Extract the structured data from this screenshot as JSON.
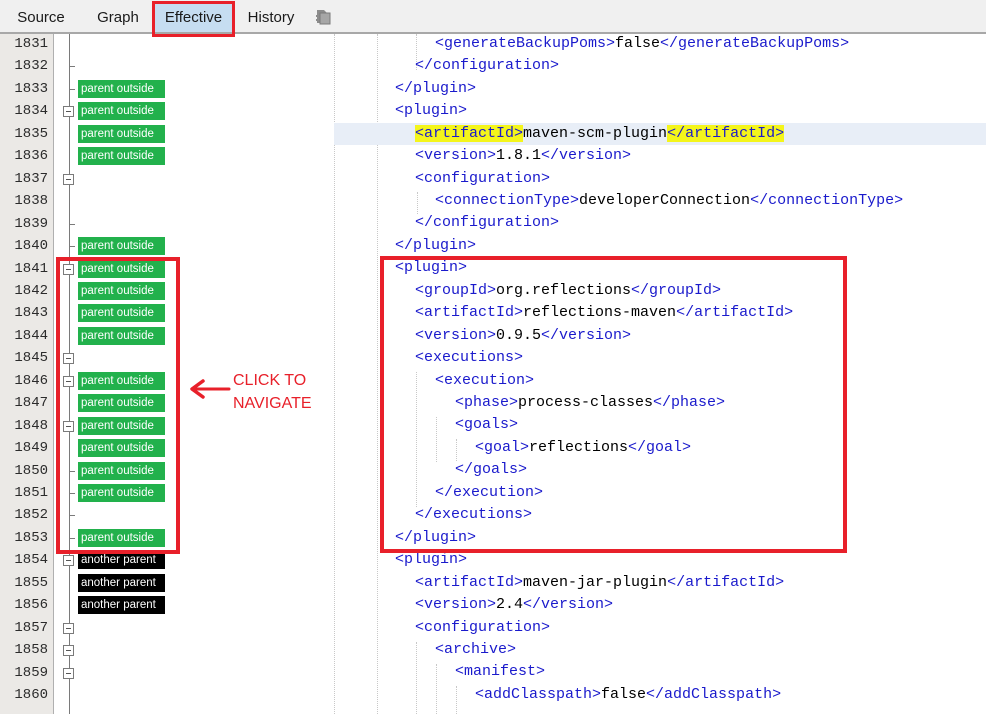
{
  "tabs": [
    {
      "label": "Source",
      "active": false
    },
    {
      "label": "Graph",
      "active": false
    },
    {
      "label": "Effective",
      "active": true
    },
    {
      "label": "History",
      "active": false
    }
  ],
  "toolbar_icon": "document-copy-icon",
  "colors": {
    "badge_parent_outside": "#22b14c",
    "badge_another_parent": "#000000",
    "annotation_red": "#e8202a",
    "tag_blue": "#1a1acc",
    "highlight_yellow": "#f4f51b",
    "active_tab": "#c6ddf1"
  },
  "lines": [
    {
      "no": "1831",
      "badge": null,
      "fold": false,
      "tick": false,
      "indent": 2,
      "parts": [
        [
          "t",
          "<generateBackupPoms>"
        ],
        [
          "x",
          "false"
        ],
        [
          "t",
          "</generateBackupPoms>"
        ]
      ]
    },
    {
      "no": "1832",
      "badge": null,
      "fold": false,
      "tick": true,
      "indent": 1,
      "parts": [
        [
          "t",
          "</configuration>"
        ]
      ]
    },
    {
      "no": "1833",
      "badge": "parent outside",
      "badge_kind": "green",
      "fold": false,
      "tick": true,
      "indent": 0,
      "parts": [
        [
          "t",
          "</plugin>"
        ]
      ]
    },
    {
      "no": "1834",
      "badge": "parent outside",
      "badge_kind": "green",
      "fold": true,
      "tick": false,
      "indent": 0,
      "parts": [
        [
          "t",
          "<plugin>"
        ]
      ]
    },
    {
      "no": "1835",
      "badge": "parent outside",
      "badge_kind": "green",
      "fold": false,
      "tick": false,
      "indent": 1,
      "current": true,
      "parts": [
        [
          "th",
          "<artifactId>"
        ],
        [
          "x",
          "maven-scm-plugin"
        ],
        [
          "th",
          "</artifactId>"
        ]
      ]
    },
    {
      "no": "1836",
      "badge": "parent outside",
      "badge_kind": "green",
      "fold": false,
      "tick": false,
      "indent": 1,
      "parts": [
        [
          "t",
          "<version>"
        ],
        [
          "x",
          "1.8.1"
        ],
        [
          "t",
          "</version>"
        ]
      ]
    },
    {
      "no": "1837",
      "badge": null,
      "fold": true,
      "tick": false,
      "indent": 1,
      "parts": [
        [
          "t",
          "<configuration>"
        ]
      ]
    },
    {
      "no": "1838",
      "badge": null,
      "fold": false,
      "tick": false,
      "indent": 2,
      "parts": [
        [
          "t",
          "<connectionType>"
        ],
        [
          "x",
          "developerConnection"
        ],
        [
          "t",
          "</connectionType>"
        ]
      ]
    },
    {
      "no": "1839",
      "badge": null,
      "fold": false,
      "tick": true,
      "indent": 1,
      "parts": [
        [
          "t",
          "</configuration>"
        ]
      ]
    },
    {
      "no": "1840",
      "badge": "parent outside",
      "badge_kind": "green",
      "fold": false,
      "tick": true,
      "indent": 0,
      "parts": [
        [
          "t",
          "</plugin>"
        ]
      ]
    },
    {
      "no": "1841",
      "badge": "parent outside",
      "badge_kind": "green",
      "fold": true,
      "tick": false,
      "indent": 0,
      "parts": [
        [
          "t",
          "<plugin>"
        ]
      ]
    },
    {
      "no": "1842",
      "badge": "parent outside",
      "badge_kind": "green",
      "fold": false,
      "tick": false,
      "indent": 1,
      "parts": [
        [
          "t",
          "<groupId>"
        ],
        [
          "x",
          "org.reflections"
        ],
        [
          "t",
          "</groupId>"
        ]
      ]
    },
    {
      "no": "1843",
      "badge": "parent outside",
      "badge_kind": "green",
      "fold": false,
      "tick": false,
      "indent": 1,
      "parts": [
        [
          "t",
          "<artifactId>"
        ],
        [
          "x",
          "reflections-maven"
        ],
        [
          "t",
          "</artifactId>"
        ]
      ]
    },
    {
      "no": "1844",
      "badge": "parent outside",
      "badge_kind": "green",
      "fold": false,
      "tick": false,
      "indent": 1,
      "parts": [
        [
          "t",
          "<version>"
        ],
        [
          "x",
          "0.9.5"
        ],
        [
          "t",
          "</version>"
        ]
      ]
    },
    {
      "no": "1845",
      "badge": null,
      "fold": true,
      "tick": false,
      "indent": 1,
      "parts": [
        [
          "t",
          "<executions>"
        ]
      ]
    },
    {
      "no": "1846",
      "badge": "parent outside",
      "badge_kind": "green",
      "fold": true,
      "tick": false,
      "indent": 2,
      "parts": [
        [
          "t",
          "<execution>"
        ]
      ]
    },
    {
      "no": "1847",
      "badge": "parent outside",
      "badge_kind": "green",
      "fold": false,
      "tick": false,
      "indent": 3,
      "parts": [
        [
          "t",
          "<phase>"
        ],
        [
          "x",
          "process-classes"
        ],
        [
          "t",
          "</phase>"
        ]
      ]
    },
    {
      "no": "1848",
      "badge": "parent outside",
      "badge_kind": "green",
      "fold": true,
      "tick": false,
      "indent": 3,
      "parts": [
        [
          "t",
          "<goals>"
        ]
      ]
    },
    {
      "no": "1849",
      "badge": "parent outside",
      "badge_kind": "green",
      "fold": false,
      "tick": false,
      "indent": 4,
      "parts": [
        [
          "t",
          "<goal>"
        ],
        [
          "x",
          "reflections"
        ],
        [
          "t",
          "</goal>"
        ]
      ]
    },
    {
      "no": "1850",
      "badge": "parent outside",
      "badge_kind": "green",
      "fold": false,
      "tick": true,
      "indent": 3,
      "parts": [
        [
          "t",
          "</goals>"
        ]
      ]
    },
    {
      "no": "1851",
      "badge": "parent outside",
      "badge_kind": "green",
      "fold": false,
      "tick": true,
      "indent": 2,
      "parts": [
        [
          "t",
          "</execution>"
        ]
      ]
    },
    {
      "no": "1852",
      "badge": null,
      "fold": false,
      "tick": true,
      "indent": 1,
      "parts": [
        [
          "t",
          "</executions>"
        ]
      ]
    },
    {
      "no": "1853",
      "badge": "parent outside",
      "badge_kind": "green",
      "fold": false,
      "tick": true,
      "indent": 0,
      "parts": [
        [
          "t",
          "</plugin>"
        ]
      ]
    },
    {
      "no": "1854",
      "badge": "another parent",
      "badge_kind": "black",
      "fold": true,
      "tick": false,
      "indent": 0,
      "parts": [
        [
          "t",
          "<plugin>"
        ]
      ]
    },
    {
      "no": "1855",
      "badge": "another parent",
      "badge_kind": "black",
      "fold": false,
      "tick": false,
      "indent": 1,
      "parts": [
        [
          "t",
          "<artifactId>"
        ],
        [
          "x",
          "maven-jar-plugin"
        ],
        [
          "t",
          "</artifactId>"
        ]
      ]
    },
    {
      "no": "1856",
      "badge": "another parent",
      "badge_kind": "black",
      "fold": false,
      "tick": false,
      "indent": 1,
      "parts": [
        [
          "t",
          "<version>"
        ],
        [
          "x",
          "2.4"
        ],
        [
          "t",
          "</version>"
        ]
      ]
    },
    {
      "no": "1857",
      "badge": null,
      "fold": true,
      "tick": false,
      "indent": 1,
      "parts": [
        [
          "t",
          "<configuration>"
        ]
      ]
    },
    {
      "no": "1858",
      "badge": null,
      "fold": true,
      "tick": false,
      "indent": 2,
      "parts": [
        [
          "t",
          "<archive>"
        ]
      ]
    },
    {
      "no": "1859",
      "badge": null,
      "fold": true,
      "tick": false,
      "indent": 3,
      "parts": [
        [
          "t",
          "<manifest>"
        ]
      ]
    },
    {
      "no": "1860",
      "badge": null,
      "fold": false,
      "tick": false,
      "indent": 4,
      "parts": [
        [
          "t",
          "<addClasspath>"
        ],
        [
          "x",
          "false"
        ],
        [
          "t",
          "</addClasspath>"
        ]
      ]
    }
  ],
  "annotation": {
    "line1": "CLICK TO",
    "line2": "NAVIGATE"
  }
}
